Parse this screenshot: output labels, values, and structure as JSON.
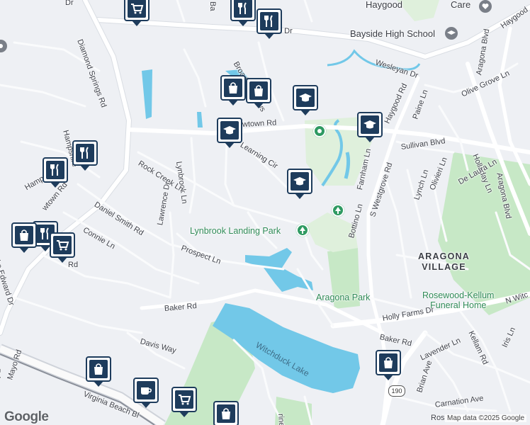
{
  "roads": {
    "diamond_springs_rd": "Diamond Springs Rd",
    "haygood_rd_top": "Haygood Rd",
    "broad_meadows": "Broad Meadows",
    "wesleyan_dr": "Wesleyan Dr",
    "olive_grove_ln": "Olive Grove Ln",
    "paine_ln": "Paine Ln",
    "haygood_rd": "Haygood Rd",
    "sullivan_blvd": "Sullivan Blvd",
    "holladay_ln": "Holladay Ln",
    "aragona_blvd": "Aragona Blvd",
    "aragona_blvd_2": "Aragona Blvd",
    "hampshire_1": "Hampshire",
    "hampshire_2": "Hampshi",
    "towne_rd": "wtown Rd",
    "learning_cir": "Learning Cir",
    "lynbrook_ln": "Lynbrook Ln",
    "rock_creek_ln": "Rock Creek Ln",
    "farnham_ln": "Farnham Ln",
    "s_westgrove_rd": "S Westgrove Rd",
    "lynch_ln": "Lynch Ln",
    "olivieri_ln": "Olivieri Ln",
    "de_laura_ln": "De Laura Ln",
    "wtown_rd_left": "wtown Rd",
    "daniel_smith_rd": "Daniel Smith Rd",
    "connie_ln": "Connie Ln",
    "lawrence_dr": "Lawrence Dr",
    "prospect_ln": "Prospect Ln",
    "bottino_ln": "Bottino Ln",
    "lake_edward_dr": "Lake Edward Dr",
    "rd_left": "Rd",
    "baker_rd": "Baker Rd",
    "baker_rd_2": "Baker Rd",
    "holly_farms_dr": "Holly Farms Dr",
    "n_witch": "N Witc",
    "kellam_rd": "Kellam Rd",
    "iris_ln": "Iris Ln",
    "davis_way": "Davis Way",
    "lavender_ln": "Lavender Ln",
    "brian_ave": "Brian Ave",
    "carnation_ave": "Carnation Ave",
    "ros": "Ros",
    "mayo_rd": "Mayo Rd",
    "virginia_beach_blvd": "Virginia Beach Bl",
    "rd_bottom_left": "Rd",
    "rine_st": "rine St",
    "wesleyan_top": "n Dr",
    "ba_top": "Ba",
    "dr_top": "Dr",
    "haygood_top": "Haygood",
    "care": "Care",
    "aragona_ve": "Aragona ve"
  },
  "places": {
    "bayside_high_school": "Bayside High School",
    "lynbrook_landing_park": "Lynbrook Landing Park",
    "aragona_village": "ARAGONA\nVILLAGE",
    "aragona_park": "Aragona Park",
    "rosewood_kellum": "Rosewood-Kellum\nFuneral Home",
    "witchduck_lake": "Witchduck Lake"
  },
  "shields": {
    "route_190": "190"
  },
  "attribution": {
    "logo": "Google",
    "map_data": "Map data ©2025 Google"
  },
  "markers": [
    {
      "type": "grocery-cart",
      "name": "grocery-marker-top"
    },
    {
      "type": "restaurant",
      "name": "restaurant-marker-top-1"
    },
    {
      "type": "restaurant",
      "name": "restaurant-marker-top-2"
    },
    {
      "type": "shopping-bag",
      "name": "shopping-marker-top-1"
    },
    {
      "type": "shopping-bag",
      "name": "shopping-marker-top-2"
    },
    {
      "type": "school",
      "name": "school-marker-1"
    },
    {
      "type": "school",
      "name": "school-marker-2"
    },
    {
      "type": "school",
      "name": "school-marker-3"
    },
    {
      "type": "school",
      "name": "school-marker-4"
    },
    {
      "type": "restaurant",
      "name": "restaurant-marker-left-1"
    },
    {
      "type": "restaurant",
      "name": "restaurant-marker-left-2"
    },
    {
      "type": "restaurant",
      "name": "restaurant-marker-left-3"
    },
    {
      "type": "shopping-bag",
      "name": "shopping-marker-left"
    },
    {
      "type": "grocery-cart",
      "name": "grocery-marker-left"
    },
    {
      "type": "shopping-bag",
      "name": "shopping-marker-bottom-1"
    },
    {
      "type": "cafe",
      "name": "cafe-marker-bottom"
    },
    {
      "type": "grocery-cart",
      "name": "grocery-marker-bottom"
    },
    {
      "type": "shopping-bag",
      "name": "shopping-marker-bottom-2"
    },
    {
      "type": "shopping-bag",
      "name": "shopping-marker-bottom-3"
    }
  ]
}
